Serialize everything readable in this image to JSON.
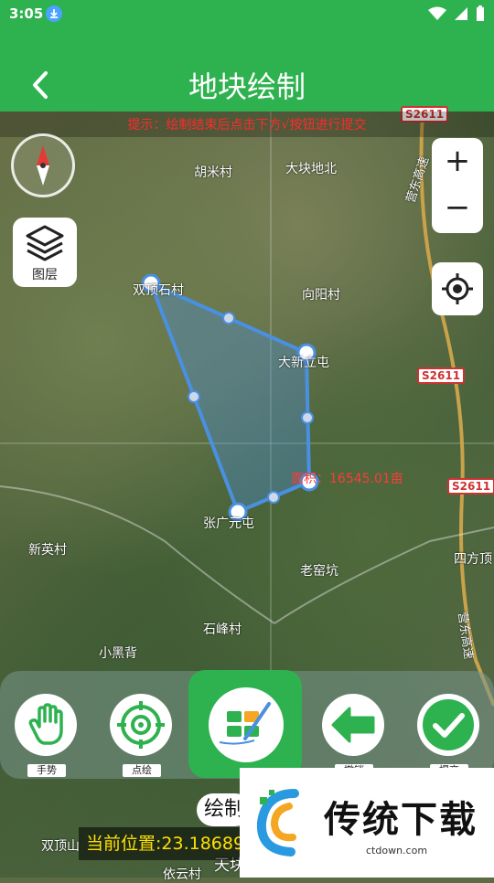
{
  "status": {
    "time": "3:05"
  },
  "appbar": {
    "title": "地块绘制"
  },
  "hint": "提示：绘制结束后点击下方√按钮进行提交",
  "layers": {
    "label": "图层"
  },
  "map_labels": [
    {
      "text": "胡米村"
    },
    {
      "text": "大块地北"
    },
    {
      "text": "双顶石村"
    },
    {
      "text": "向阳村"
    },
    {
      "text": "大新立屯"
    },
    {
      "text": "张广元屯"
    },
    {
      "text": "新英村"
    },
    {
      "text": "老窑坑"
    },
    {
      "text": "石峰村"
    },
    {
      "text": "小黑背"
    },
    {
      "text": "四方顶"
    },
    {
      "text": "双顶山"
    },
    {
      "text": "依云村"
    },
    {
      "text": "天块"
    },
    {
      "text": "营东高速"
    },
    {
      "text": "营东高速"
    }
  ],
  "road_badges": [
    "S2611",
    "S2611",
    "S2611"
  ],
  "area_text": "面积：16545.01亩",
  "toolbar": {
    "gesture_label": "手势",
    "point_label": "点绘",
    "undo_label": "撤销",
    "done_label": "提交"
  },
  "mode": "绘制",
  "position": "当前位置:23.18689",
  "watermark": {
    "name": "传统下载",
    "url": "ctdown.com"
  },
  "colors": {
    "primary": "#2eb24f",
    "polygon": "#4a90e2",
    "hint": "#ff2a2a",
    "position": "#ffe000"
  }
}
